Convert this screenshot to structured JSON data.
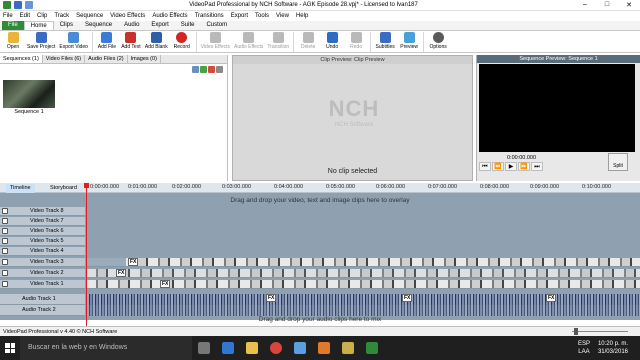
{
  "window": {
    "title": "VideoPad Professional by NCH Software - AGK Episode 28.vpj* - Licensed to Ivan187",
    "controls": [
      "–",
      "□",
      "✕"
    ]
  },
  "menubar": [
    "File",
    "Edit",
    "Clip",
    "Track",
    "Sequence",
    "Video Effects",
    "Audio Effects",
    "Transitions",
    "Export",
    "Tools",
    "View",
    "Help"
  ],
  "ribbon_tabs": [
    "File",
    "Home",
    "Clips",
    "Sequence",
    "Audio",
    "Export",
    "Suite",
    "Custom"
  ],
  "toolbar": [
    {
      "label": "Open",
      "icon": "folder-icon",
      "color": "#e8b53a",
      "enabled": true
    },
    {
      "label": "Save Project",
      "icon": "save-icon",
      "color": "#3a6cc4",
      "enabled": true
    },
    {
      "label": "Export Video",
      "icon": "export-icon",
      "color": "#4a8ad6",
      "enabled": true
    },
    {
      "label": "Add File",
      "icon": "add-file-icon",
      "color": "#3c7ad8",
      "enabled": true
    },
    {
      "label": "Add Text",
      "icon": "add-text-icon",
      "color": "#c8322d",
      "enabled": true
    },
    {
      "label": "Add Blank",
      "icon": "add-blank-icon",
      "color": "#2d5ea8",
      "enabled": true
    },
    {
      "label": "Record",
      "icon": "record-icon",
      "color": "#d42323",
      "enabled": true
    },
    {
      "label": "Video Effects",
      "icon": "video-effects-icon",
      "color": "#b9b9b9",
      "enabled": false
    },
    {
      "label": "Audio Effects",
      "icon": "audio-effects-icon",
      "color": "#b9b9b9",
      "enabled": false
    },
    {
      "label": "Transition",
      "icon": "transition-icon",
      "color": "#b9b9b9",
      "enabled": false
    },
    {
      "label": "Delete",
      "icon": "delete-icon",
      "color": "#b9b9b9",
      "enabled": false
    },
    {
      "label": "Undo",
      "icon": "undo-icon",
      "color": "#2f6bc4",
      "enabled": true
    },
    {
      "label": "Redo",
      "icon": "redo-icon",
      "color": "#b9b9b9",
      "enabled": false
    },
    {
      "label": "Subtitles",
      "icon": "subtitles-icon",
      "color": "#3a6cc4",
      "enabled": true
    },
    {
      "label": "Preview",
      "icon": "preview-icon",
      "color": "#4aa0d8",
      "enabled": true
    },
    {
      "label": "Options",
      "icon": "options-icon",
      "color": "#5a5a5a",
      "enabled": true
    }
  ],
  "left_panel": {
    "tabs": [
      "Sequences (1)",
      "Video Files (6)",
      "Audio Files (2)",
      "Images (0)"
    ],
    "sequence_label": "Sequence 1"
  },
  "clip_preview": {
    "title": "Clip Preview: Clip Preview",
    "logo_big": "NCH",
    "logo_small": "NCH Software",
    "empty_text": "No clip selected"
  },
  "sequence_preview": {
    "title": "Sequence Preview: Sequence 1",
    "time": "0:00:00.000",
    "controls": [
      "⏮",
      "⏪",
      "▶",
      "⏩",
      "⏭"
    ],
    "split_label": "Split"
  },
  "timeline": {
    "tabs": [
      "Timeline",
      "Storyboard"
    ],
    "ruler": [
      "0:00:00.000",
      "0:01:00.000",
      "0:02:00.000",
      "0:03:00.000",
      "0:04:00.000",
      "0:05:00.000",
      "0:06:00.000",
      "0:07:00.000",
      "0:08:00.000",
      "0:09:00.000",
      "0:10:00.000"
    ],
    "drop_video": "Drag and drop your video, text and image clips here to overlay",
    "video_tracks": [
      "Video Track 8",
      "Video Track 7",
      "Video Track 6",
      "Video Track 5",
      "Video Track 4",
      "Video Track 3",
      "Video Track 2",
      "Video Track 1"
    ],
    "audio_tracks": [
      "Audio Track 1",
      "Audio Track 2"
    ],
    "drop_audio": "Drag and drop your audio clips here to mix",
    "fx_label": "FX"
  },
  "status": {
    "text": "VideoPad Professional v 4.40 © NCH Software"
  },
  "taskbar": {
    "search_placeholder": "Buscar en la web y en Windows",
    "lang_top": "ESP",
    "lang_bottom": "LAA",
    "time": "10:20 p. m.",
    "date": "31/03/2016"
  }
}
